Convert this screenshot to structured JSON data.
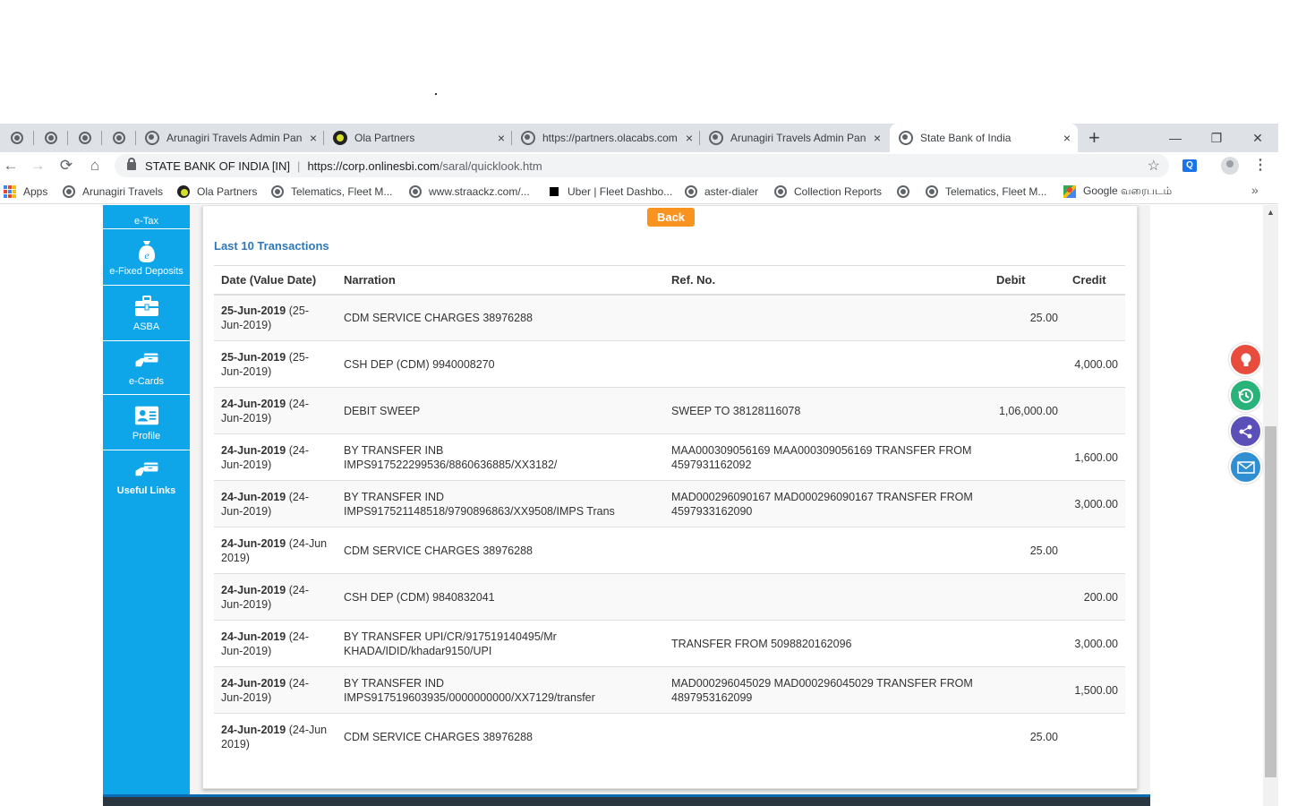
{
  "browser": {
    "tabs": [
      {
        "title": "Arunagiri Travels Admin Panel",
        "favicon": "globe-icon"
      },
      {
        "title": "Ola Partners",
        "favicon": "ola-icon"
      },
      {
        "title": "https://partners.olacabs.com",
        "favicon": "globe-icon"
      },
      {
        "title": "Arunagiri Travels Admin Panel",
        "favicon": "globe-icon"
      },
      {
        "title": "State Bank of India",
        "favicon": "globe-icon",
        "active": true
      }
    ],
    "new_tab": "+",
    "close_glyph": "×",
    "window_controls": {
      "minimize": "—",
      "maximize": "❐",
      "close": "✕"
    },
    "nav": {
      "back": "←",
      "forward": "→",
      "reload": "⟳",
      "home": "⌂"
    },
    "site_name": "STATE BANK OF INDIA [IN]",
    "url_host": "https://corp.onlinesbi.com",
    "url_path": "/saral/quicklook.htm",
    "star": "☆",
    "menu": "⋮",
    "bookmarks": [
      {
        "label": "Apps",
        "icon": "apps-icon"
      },
      {
        "label": "Arunagiri Travels",
        "icon": "globe-icon"
      },
      {
        "label": "Ola Partners",
        "icon": "ola-icon"
      },
      {
        "label": "Telematics, Fleet M...",
        "icon": "globe-icon"
      },
      {
        "label": "www.straackz.com/...",
        "icon": "globe-icon"
      },
      {
        "label": "Uber | Fleet Dashbo...",
        "icon": "uber-icon"
      },
      {
        "label": "aster-dialer",
        "icon": "globe-icon"
      },
      {
        "label": "Collection Reports",
        "icon": "globe-icon"
      },
      {
        "label": "",
        "icon": "globe-icon"
      },
      {
        "label": "Telematics, Fleet M...",
        "icon": "globe-icon"
      },
      {
        "label": "Google வரைபடம்",
        "icon": "maps-icon"
      }
    ],
    "bookmarks_more": "»"
  },
  "sidebar": {
    "items": [
      {
        "label": "e-Tax",
        "icon": "tax-icon"
      },
      {
        "label": "e-Fixed Deposits",
        "icon": "money-bag-icon"
      },
      {
        "label": "ASBA",
        "icon": "briefcase-icon"
      },
      {
        "label": "e-Cards",
        "icon": "cards-icon"
      },
      {
        "label": "Profile",
        "icon": "profile-card-icon"
      },
      {
        "label": "Useful Links",
        "icon": "links-icon"
      }
    ]
  },
  "main": {
    "back_label": "Back",
    "section_title": "Last 10 Transactions",
    "columns": [
      "Date (Value Date)",
      "Narration",
      "Ref. No.",
      "Debit",
      "Credit"
    ],
    "rows": [
      {
        "date": "25-Jun-2019",
        "value_date": "(25-Jun-2019)",
        "narration": "CDM SERVICE CHARGES 38976288",
        "ref": "",
        "debit": "25.00",
        "credit": ""
      },
      {
        "date": "25-Jun-2019",
        "value_date": "(25-Jun-2019)",
        "narration": "CSH DEP (CDM) 9940008270",
        "ref": "",
        "debit": "",
        "credit": "4,000.00"
      },
      {
        "date": "24-Jun-2019",
        "value_date": "(24-Jun-2019)",
        "narration": "DEBIT SWEEP",
        "ref": "SWEEP TO 38128116078",
        "debit": "1,06,000.00",
        "credit": ""
      },
      {
        "date": "24-Jun-2019",
        "value_date": "(24-Jun-2019)",
        "narration": "BY TRANSFER INB IMPS917522299536/8860636885/XX3182/",
        "ref": "MAA000309056169 MAA000309056169 TRANSFER FROM 4597931162092",
        "debit": "",
        "credit": "1,600.00"
      },
      {
        "date": "24-Jun-2019",
        "value_date": "(24-Jun-2019)",
        "narration": "BY TRANSFER IND IMPS917521148518/9790896863/XX9508/IMPS Trans",
        "ref": "MAD000296090167 MAD000296090167 TRANSFER FROM 4597933162090",
        "debit": "",
        "credit": "3,000.00"
      },
      {
        "date": "24-Jun-2019",
        "value_date": "(24-Jun 2019)",
        "narration": "CDM SERVICE CHARGES 38976288",
        "ref": "",
        "debit": "25.00",
        "credit": ""
      },
      {
        "date": "24-Jun-2019",
        "value_date": "(24-Jun-2019)",
        "narration": "CSH DEP (CDM) 9840832041",
        "ref": "",
        "debit": "",
        "credit": "200.00"
      },
      {
        "date": "24-Jun-2019",
        "value_date": "(24-Jun-2019)",
        "narration": "BY TRANSFER UPI/CR/917519140495/Mr KHADA/IDID/khadar9150/UPI",
        "ref": "TRANSFER FROM 5098820162096",
        "debit": "",
        "credit": "3,000.00"
      },
      {
        "date": "24-Jun-2019",
        "value_date": "(24-Jun-2019)",
        "narration": "BY TRANSFER IND IMPS917519603935/0000000000/XX7129/transfer",
        "ref": "MAD000296045029 MAD000296045029 TRANSFER FROM 4897953162099",
        "debit": "",
        "credit": "1,500.00"
      },
      {
        "date": "24-Jun-2019",
        "value_date": "(24-Jun 2019)",
        "narration": "CDM SERVICE CHARGES 38976288",
        "ref": "",
        "debit": "25.00",
        "credit": ""
      }
    ]
  },
  "floating_buttons": [
    {
      "name": "idea-button",
      "icon": "bulb-icon",
      "color": "#e84c3d"
    },
    {
      "name": "history-button",
      "icon": "clock-icon",
      "color": "#2ab27b"
    },
    {
      "name": "share-button",
      "icon": "share-icon",
      "color": "#5b4fb8"
    },
    {
      "name": "mail-button",
      "icon": "mail-icon",
      "color": "#2f8fd1"
    }
  ]
}
